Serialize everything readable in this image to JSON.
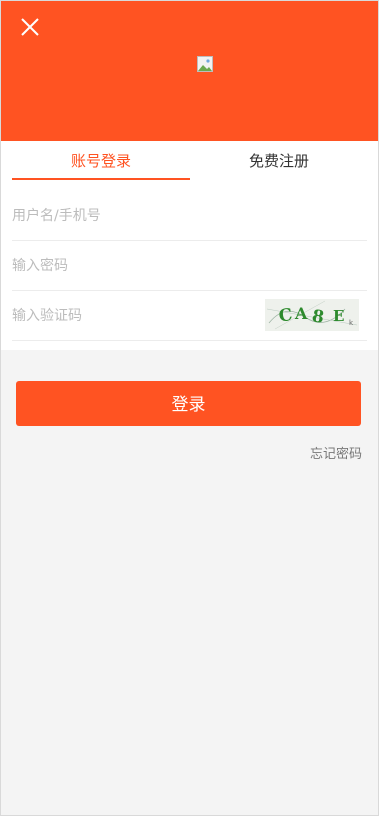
{
  "tabs": {
    "login": "账号登录",
    "register": "免费注册"
  },
  "fields": {
    "username_placeholder": "用户名/手机号",
    "password_placeholder": "输入密码",
    "captcha_placeholder": "输入验证码"
  },
  "captcha_text": "CA8E",
  "login_button": "登录",
  "forgot_password": "忘记密码",
  "colors": {
    "accent": "#ff5322",
    "background": "#f4f4f4"
  },
  "icons": {
    "close": "close-icon",
    "logo": "broken-image-icon"
  }
}
